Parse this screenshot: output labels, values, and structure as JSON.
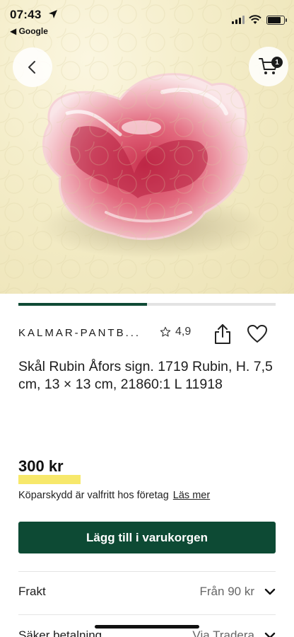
{
  "status_bar": {
    "time": "07:43",
    "back_app": "◀ Google",
    "battery_level": 0.85
  },
  "cart": {
    "count": "1"
  },
  "gallery": {
    "progress_fraction": 0.5
  },
  "seller": {
    "name": "KALMAR-PANTB...",
    "rating": "4,9"
  },
  "item": {
    "title": "Skål Rubin Åfors sign. 1719 Rubin, H. 7,5 cm, 13 × 13 cm, 21860:1 L 11918",
    "price": "300 kr"
  },
  "buyer_protection": {
    "text": "Köparskydd är valfritt hos företag",
    "link": "Läs mer"
  },
  "add_to_cart_label": "Lägg till i varukorgen",
  "info_rows": [
    {
      "label": "Frakt",
      "value": "Från 90 kr"
    },
    {
      "label": "Säker betalning",
      "value": "Via Tradera"
    }
  ],
  "colors": {
    "brand_green": "#0d4a34",
    "price_highlight": "#f7e86b"
  }
}
